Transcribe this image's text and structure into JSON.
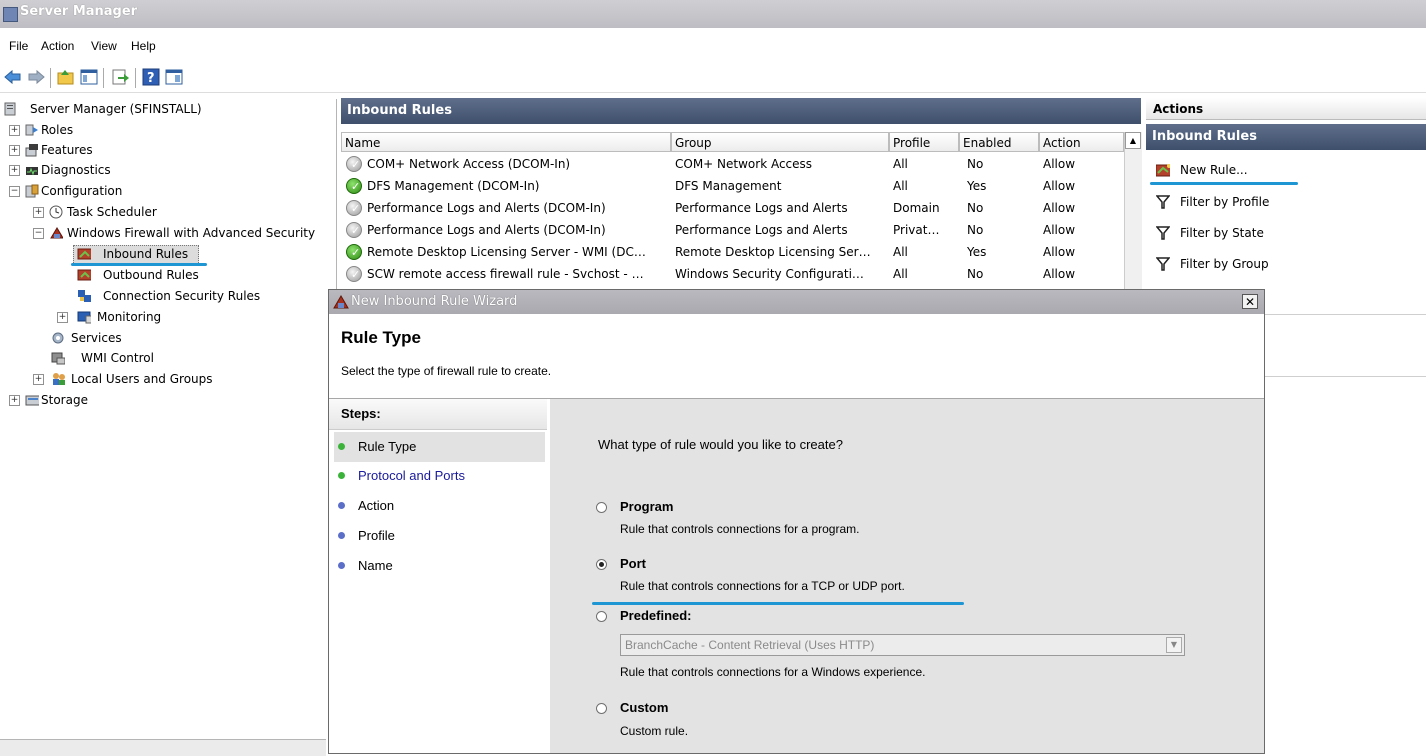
{
  "window": {
    "title": "Server Manager"
  },
  "menu": [
    "File",
    "Action",
    "View",
    "Help"
  ],
  "tree": {
    "root": "Server Manager (SFINSTALL)",
    "roles": "Roles",
    "features": "Features",
    "diagnostics": "Diagnostics",
    "configuration": "Configuration",
    "task_scheduler": "Task Scheduler",
    "firewall": "Windows Firewall with Advanced Security",
    "inbound": "Inbound Rules",
    "outbound": "Outbound Rules",
    "connsec": "Connection Security Rules",
    "monitoring": "Monitoring",
    "services": "Services",
    "wmi": "WMI Control",
    "local_users": "Local Users and Groups",
    "storage": "Storage"
  },
  "center": {
    "title": "Inbound Rules",
    "columns": [
      "Name",
      "Group",
      "Profile",
      "Enabled",
      "Action"
    ],
    "rows": [
      {
        "name": "COM+ Network Access (DCOM-In)",
        "group": "COM+ Network Access",
        "profile": "All",
        "enabled": "No",
        "action": "Allow",
        "status": "disabled"
      },
      {
        "name": "DFS Management (DCOM-In)",
        "group": "DFS Management",
        "profile": "All",
        "enabled": "Yes",
        "action": "Allow",
        "status": "enabled"
      },
      {
        "name": "Performance Logs and Alerts (DCOM-In)",
        "group": "Performance Logs and Alerts",
        "profile": "Domain",
        "enabled": "No",
        "action": "Allow",
        "status": "disabled"
      },
      {
        "name": "Performance Logs and Alerts (DCOM-In)",
        "group": "Performance Logs and Alerts",
        "profile": "Privat…",
        "enabled": "No",
        "action": "Allow",
        "status": "disabled"
      },
      {
        "name": "Remote Desktop Licensing Server - WMI (DC…",
        "group": "Remote Desktop Licensing Ser…",
        "profile": "All",
        "enabled": "Yes",
        "action": "Allow",
        "status": "enabled"
      },
      {
        "name": "SCW remote access firewall rule - Svchost - …",
        "group": "Windows Security Configurati…",
        "profile": "All",
        "enabled": "No",
        "action": "Allow",
        "status": "disabled"
      }
    ]
  },
  "actions": {
    "title": "Actions",
    "section": "Inbound Rules",
    "items": [
      "New Rule...",
      "Filter by Profile",
      "Filter by State",
      "Filter by Group"
    ]
  },
  "wizard": {
    "title": "New Inbound Rule Wizard",
    "heading": "Rule Type",
    "subtitle": "Select the type of firewall rule to create.",
    "steps_label": "Steps:",
    "steps": [
      {
        "label": "Rule Type",
        "state": "current"
      },
      {
        "label": "Protocol and Ports",
        "state": "link"
      },
      {
        "label": "Action",
        "state": "pending"
      },
      {
        "label": "Profile",
        "state": "pending"
      },
      {
        "label": "Name",
        "state": "pending"
      }
    ],
    "question": "What type of rule would you like to create?",
    "options": [
      {
        "title": "Program",
        "desc": "Rule that controls connections for a program.",
        "selected": false
      },
      {
        "title": "Port",
        "desc": "Rule that controls connections for a TCP or UDP port.",
        "selected": true
      },
      {
        "title": "Predefined:",
        "desc": "Rule that controls connections for a Windows experience.",
        "selected": false
      },
      {
        "title": "Custom",
        "desc": "Custom rule.",
        "selected": false
      }
    ],
    "predefined_value": "BranchCache - Content Retrieval (Uses HTTP)"
  },
  "colors": {
    "highlight": "#1d96d3",
    "pane_header": "#4a5a78",
    "enabled_icon": "#2d8a12",
    "link": "#1a1a9c"
  }
}
